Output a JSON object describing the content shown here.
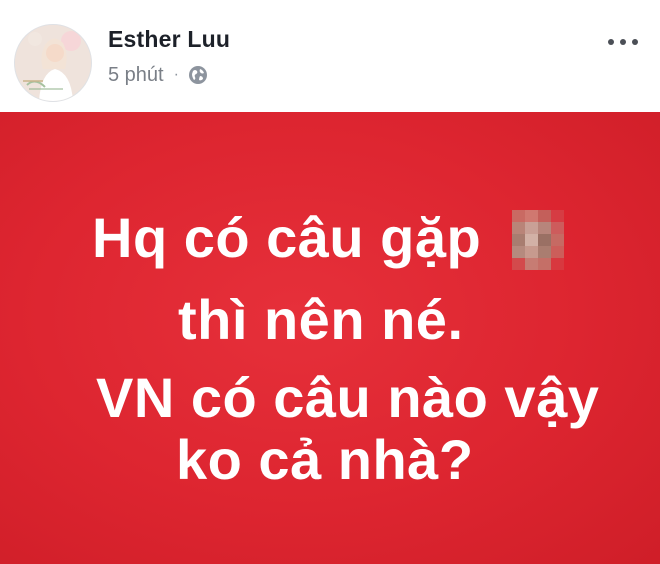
{
  "post": {
    "author_name": "Esther Luu",
    "timestamp": "5 phút",
    "separator": "·",
    "privacy_icon": "globe-icon",
    "more_icon": "more-options-icon"
  },
  "content": {
    "line1": "Hq có câu gặp",
    "censored_icon": "pixelated-emoji",
    "line2": "thì nên né.",
    "line3": "VN có câu nào vậy",
    "line4": "ko cả nhà?"
  },
  "colors": {
    "background": "#de2530",
    "text": "#ffffff",
    "name": "#1d2129",
    "meta": "#7a7f87"
  }
}
